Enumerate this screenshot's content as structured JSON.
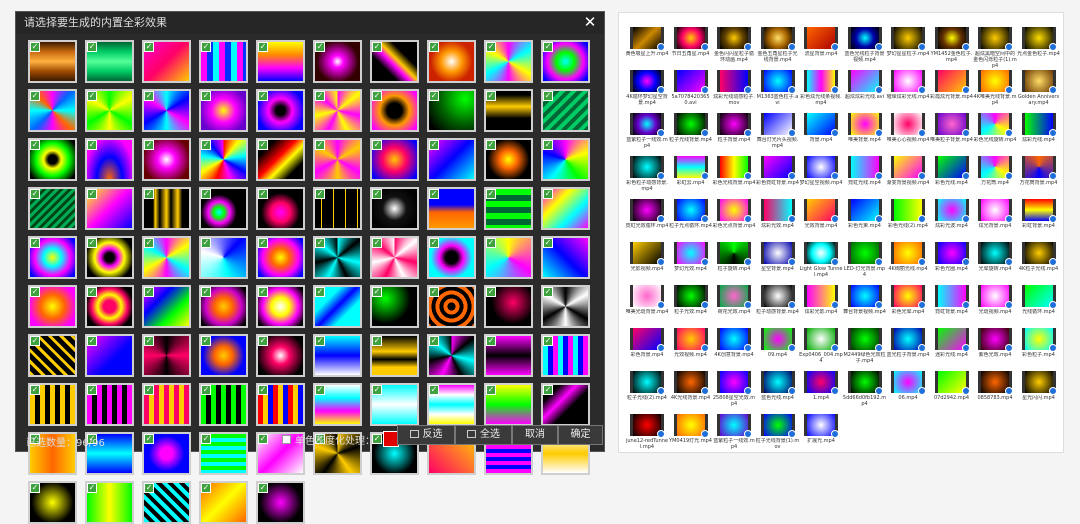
{
  "dialog": {
    "title": "请选择要生成的内置全彩效果",
    "close_label": "✕",
    "selected_count": "已选数量：96/96",
    "grayscale_label": "单色灰度化处理：",
    "grayscale_color": "#e00000",
    "buttons": {
      "invert": "反选",
      "select_all": "全选",
      "cancel": "取消",
      "ok": "确定"
    },
    "check_mark": "✓",
    "effects_accent": "#3da13d"
  },
  "effects": [
    "linear-gradient(180deg,#3a1a00,#c86a10,#ffb040,#a04a00,#3a1a00)",
    "linear-gradient(180deg,#063,#0c6,#5f9,#0c6,#063)",
    "linear-gradient(135deg,#f0c,#f06,#fc0)",
    "repeating-linear-gradient(90deg,#f0f 0 6px,#03f 6px 12px,#0ff 12px 18px)",
    "linear-gradient(180deg,#ff0,#f80,#f0f,#00f)",
    "radial-gradient(circle,#fff 0,#f0f 20%,#300 70%)",
    "linear-gradient(45deg,#000 30%,#f0f 45%,#fc0 55%,#000 70%)",
    "radial-gradient(circle,#fff 0,#f90 35%,#c20 70%)",
    "conic-gradient(#f0f,#0ff,#ff0,#f0f,#0ff,#ff0,#f0f)",
    "radial-gradient(circle,#0ff 0,#0f0 30%,#f0f 60%,#00f 90%)",
    "conic-gradient(#f0f,#06f,#0ff,#f60,#f0f,#06f,#0ff,#f60,#f0f)",
    "conic-gradient(#0f0,#ff0,#0f0,#ff0,#0f0,#ff0,#0f0)",
    "conic-gradient(#0ff,#00f,#f0f,#0ff,#00f,#f0f,#0ff)",
    "radial-gradient(circle,#ff0 0,#f0f 40%,#60c 80%)",
    "radial-gradient(circle,#000 15%,#f0f 40%,#00f 80%)",
    "conic-gradient(#f0f,#ff0,#f0f,#ff0,#f0f,#ff0,#f0f,#ff0)",
    "radial-gradient(circle,#000 25%,#f90 50%,#f0f 90%)",
    "radial-gradient(circle at 80% 20%,#0f0,#060 50%,#000 90%)",
    "linear-gradient(180deg,#000 10%,#fc0 40%,#000 70%)",
    "repeating-linear-gradient(135deg,#063 0 4px,#0c6 4px 8px)",
    "radial-gradient(circle,#000 15%,#ff0 30%,#0f0 55%,#000 90%)",
    "radial-gradient(ellipse at 50% 100%,#f60 0,#00f 40%,#f0f 80%)",
    "radial-gradient(circle,#fff 0,#f0f 30%,#600 80%)",
    "conic-gradient(#f00,#ff0,#0ff,#00f,#f0f,#f00,#ff0,#0ff,#00f,#f0f)",
    "linear-gradient(135deg,#000 20%,#f00 45%,#ff0 60%,#000 80%)",
    "conic-gradient(#f0f,#fc0,#f0f,#fc0,#f0f,#fc0,#f0f)",
    "radial-gradient(circle,#fc0 0,#f06 40%,#00f 90%)",
    "linear-gradient(135deg,#f0f,#00f 50%,#0ff)",
    "radial-gradient(circle,#ff0 0,#f60 30%,#000 70%)",
    "conic-gradient(#f0f,#ff0,#0f0,#0ff,#00f,#f0f)",
    "repeating-linear-gradient(135deg,#0a5 0 3px,#041 3px 6px)",
    "linear-gradient(135deg,#ff0,#f0f,#00f)",
    "linear-gradient(90deg,#000 20%,#fc0 25%,#000 35%,#fc0 50%,#000 60%,#fc0 75%,#000 85%)",
    "radial-gradient(circle at 40% 60%,#0ff 0,#0f0 15%,#f0f 30%,#000 50%)",
    "radial-gradient(circle at 50% 60%,#f0f 0,#f06 30%,#000 60%)",
    "repeating-linear-gradient(90deg,#000 0 6px,#fc0 6px 7px,#000 7px 12px)",
    "radial-gradient(circle,#fff 0,#111 40%,#000 80%)",
    "linear-gradient(180deg,#00f 40%,#f60 60%,#f90 100%)",
    "repeating-linear-gradient(180deg,#0f0 0 6px,#063 6px 12px)",
    "linear-gradient(135deg,#f0f,#ff0,#0ff,#f0f)",
    "radial-gradient(circle,#ff0 0,#0ff 30%,#f0f 60%,#00f 90%)",
    "radial-gradient(circle,#000 15%,#f0f 30%,#ff0 50%,#000 80%)",
    "conic-gradient(#f0f,#ff0,#0ff,#f0f,#ff0,#0ff,#f0f)",
    "conic-gradient(from 45deg,#00f,#0ff,#fff,#00f)",
    "radial-gradient(circle,#ff0 0,#f60 30%,#f0f 60%,#00f 90%)",
    "conic-gradient(#0ff,#000,#0ff,#000,#0ff,#000,#0ff,#000)",
    "conic-gradient(#f06,#fff,#f06,#fff,#f06,#fff,#f06,#fff)",
    "radial-gradient(circle,#000 20%,#f0f 40%,#0ff 70%)",
    "conic-gradient(#ff0,#f0f,#0ff,#ff0)",
    "linear-gradient(45deg,#0ff,#00f,#f0f)",
    "radial-gradient(circle,#ff0 0,#f60 40%,#f0f 80%)",
    "radial-gradient(circle,#f06 20%,#ff0 40%,#f06 60%,#000 80%)",
    "linear-gradient(135deg,#f0f,#00f,#0f0,#ff0)",
    "radial-gradient(circle,#fc0 0,#f60 30%,#c0c 60%,#000 90%)",
    "radial-gradient(circle,#fff 0,#ff0 30%,#f0f 60%,#000 90%)",
    "linear-gradient(135deg,#0ff 30%,#00f 50%,#0ff 70%)",
    "radial-gradient(circle at 30% 30%,#0f0 0,#000 60%)",
    "repeating-radial-gradient(circle,#000 0 4px,#f60 4px 8px)",
    "radial-gradient(circle at 60% 40%,#f06 0,#000 60%)",
    "conic-gradient(#000,#fff,#000,#fff,#000,#fff,#000)",
    "repeating-linear-gradient(45deg,#fc0 0 3px,#000 3px 8px)",
    "linear-gradient(135deg,#f0f,#00f 60%)",
    "conic-gradient(from 180deg,#000,#f06,#000,#f06,#000)",
    "radial-gradient(circle,#fc0 0,#f60 30%,#00f 70%)",
    "radial-gradient(circle,#fff 0,#f06 30%,#000 80%)",
    "linear-gradient(180deg,#0ff,#00f 50%,#fff)",
    "linear-gradient(180deg,#000,#fc0 40%,#000 60%,#fc0 80%)",
    "conic-gradient(#f0f,#000,#0ff,#000,#f0f,#000,#0ff,#000)",
    "linear-gradient(180deg,#f0f,#000,#f0f)",
    "repeating-linear-gradient(90deg,#0ff 0 5px,#00f 5px 10px,#f0f 10px 15px)",
    "repeating-linear-gradient(90deg,#fc0 0 5px,#000 5px 10px)",
    "repeating-linear-gradient(90deg,#f0f 0 5px,#000 5px 10px)",
    "repeating-linear-gradient(90deg,#f06 0 5px,#fc0 5px 10px)",
    "repeating-linear-gradient(90deg,#0f0 0 5px,#000 5px 10px)",
    "repeating-linear-gradient(90deg,#f00 0 5px,#fc0 5px 10px,#00f 10px 15px)",
    "linear-gradient(180deg,#fff,#0ff,#f0f,#ff0)",
    "linear-gradient(180deg,#0ff,#fff,#0ff)",
    "linear-gradient(180deg,#f0f,#fff,#0ff,#fff,#ff0)",
    "linear-gradient(180deg,#ff0,#0f0,#f0f)",
    "linear-gradient(135deg,#000 20%,#f0f 40%,#000 60%)",
    "linear-gradient(90deg,#fc0,#f60,#fc0)",
    "linear-gradient(180deg,#00f,#0ff,#00f)",
    "radial-gradient(circle,#f0f 20%,#00f 60%)",
    "repeating-linear-gradient(180deg,#0f0 0 4px,#0ff 4px 8px)",
    "linear-gradient(135deg,#fff,#f0f,#fff)",
    "conic-gradient(#fc0,#000,#fc0,#000,#fc0,#000)",
    "radial-gradient(circle,#0ff 0,#000 70%)",
    "linear-gradient(45deg,#f06,#fc0)",
    "repeating-linear-gradient(0deg,#f0f 0 4px,#00f 4px 8px)",
    "linear-gradient(180deg,#fff,#fc0,#fff)",
    "radial-gradient(circle,#ff0 0,#000 70%)",
    "linear-gradient(90deg,#0f0,#ff0,#0f0)",
    "repeating-linear-gradient(45deg,#0ff 0 4px,#000 4px 8px)",
    "linear-gradient(135deg,#f60,#ff0,#f60)",
    "radial-gradient(circle,#f0f 0,#000 70%)"
  ],
  "files": [
    {
      "name": "黄色吸星上升.mp4",
      "thumb": "linear-gradient(135deg,#000,#c80,#000)"
    },
    {
      "name": "节日五角星.mp4",
      "thumb": "radial-gradient(circle,#fc0,#f06,#000)"
    },
    {
      "name": "金色闪闪星粒子循环动画.mp4",
      "thumb": "radial-gradient(circle,#fc0,#640,#000)"
    },
    {
      "name": "金色五角星粒子光线背景.mp4",
      "thumb": "radial-gradient(circle,#fd6,#a60,#000)"
    },
    {
      "name": "流星背景.mp4",
      "thumb": "linear-gradient(135deg,#f60,#a00)"
    },
    {
      "name": "蓝色光线粒子背景视频.mp4",
      "thumb": "radial-gradient(circle,#0ff,#00a,#000)"
    },
    {
      "name": "梦幻星星粒子.mp4",
      "thumb": "radial-gradient(circle,#fc0,#000)"
    },
    {
      "name": "YM1452金色粒子.mp4",
      "thumb": "radial-gradient(circle,#ff0,#630,#000)"
    },
    {
      "name": "超炫黑暗空间中的金色闪烁粒子(1).mp4",
      "thumb": "radial-gradient(circle,#fc0,#000)"
    },
    {
      "name": "光点金色粒子.mp4",
      "thumb": "radial-gradient(circle,#fd0,#000)"
    },
    {
      "name": "4K循环梦幻星空背景.mp4",
      "thumb": "radial-gradient(circle,#f0f,#00f,#000)"
    },
    {
      "name": "5a7078420365 0.avi",
      "thumb": "linear-gradient(135deg,#00f,#f0f)"
    },
    {
      "name": "炫彩光线动感粒子.mov",
      "thumb": "linear-gradient(90deg,#f06,#00f)"
    },
    {
      "name": "M1363蓝色粒子.avi",
      "thumb": "radial-gradient(circle,#0ff,#00f)"
    },
    {
      "name": "彩色炫光线条视频.mp4",
      "thumb": "linear-gradient(90deg,#0ff,#f0f,#ff0)"
    },
    {
      "name": "超炫炫彩光线.avi",
      "thumb": "linear-gradient(135deg,#f0f,#0ff)"
    },
    {
      "name": "璀璨炫彩光线.mp4",
      "thumb": "radial-gradient(circle,#fff,#f0f)"
    },
    {
      "name": "彩霞炫光背景.mp4",
      "thumb": "linear-gradient(135deg,#f06,#fc0)"
    },
    {
      "name": "4K唯美光线背景.mp4",
      "thumb": "radial-gradient(circle,#ff0,#f60)"
    },
    {
      "name": "Golden Anniversary.mp4",
      "thumb": "radial-gradient(circle,#fd6,#630)"
    },
    {
      "name": "蓝紫粒子一线效.mp4",
      "thumb": "radial-gradient(circle,#0ff,#60c,#000)"
    },
    {
      "name": "粒子光线背景.mp4",
      "thumb": "radial-gradient(circle,#0f0,#000)"
    },
    {
      "name": "粒子背景.mp4",
      "thumb": "radial-gradient(circle,#f0f,#000)"
    },
    {
      "name": "舞台灯光片头视频.mp4",
      "thumb": "linear-gradient(135deg,#00f,#fff)"
    },
    {
      "name": "背景.mp4",
      "thumb": "linear-gradient(135deg,#0ff,#00f)"
    },
    {
      "name": "唯美背景.mp4",
      "thumb": "radial-gradient(circle,#f0f,#ff0)"
    },
    {
      "name": "唯美心心视频.mp4",
      "thumb": "radial-gradient(circle,#f06,#fff)"
    },
    {
      "name": "唯美粒子背景.mp4",
      "thumb": "radial-gradient(circle,#f6c,#60c)"
    },
    {
      "name": "彩色光线旋转.mp4",
      "thumb": "conic-gradient(#f0f,#ff0,#0ff,#f0f)"
    },
    {
      "name": "炫彩光线.mp4",
      "thumb": "linear-gradient(90deg,#0f0,#00f)"
    },
    {
      "name": "彩色粒子动感背景.mp4",
      "thumb": "radial-gradient(circle,#0ff,#000)"
    },
    {
      "name": "彩虹云.mp4",
      "thumb": "linear-gradient(180deg,#f0f,#0ff,#ff0)"
    },
    {
      "name": "彩色光线背景.mp4",
      "thumb": "linear-gradient(90deg,#f00,#ff0,#0f0)"
    },
    {
      "name": "彩色霓虹背景.mp4",
      "thumb": "linear-gradient(135deg,#f0f,#00f)"
    },
    {
      "name": "梦幻星空视频.mp4",
      "thumb": "radial-gradient(circle,#fff,#00f)"
    },
    {
      "name": "霓虹光线.mp4",
      "thumb": "linear-gradient(90deg,#0ff,#f0f)"
    },
    {
      "name": "渐变背景视频.mp4",
      "thumb": "linear-gradient(135deg,#ff0,#f0f)"
    },
    {
      "name": "彩色光线.mp4",
      "thumb": "linear-gradient(135deg,#0f0,#00f)"
    },
    {
      "name": "万花筒.mp4",
      "thumb": "conic-gradient(#f0f,#ff0,#0ff,#f0f)"
    },
    {
      "name": "万花筒背景.mp4",
      "thumb": "conic-gradient(#f60,#00f,#f60)"
    },
    {
      "name": "霓虹光效循环.mp4",
      "thumb": "radial-gradient(circle,#f0f,#000)"
    },
    {
      "name": "粒子光点循环.mp4",
      "thumb": "radial-gradient(circle,#0ff,#00f)"
    },
    {
      "name": "彩色光点背景.mp4",
      "thumb": "radial-gradient(circle,#ff0,#f0f)"
    },
    {
      "name": "炫彩光效.mp4",
      "thumb": "linear-gradient(90deg,#f06,#0ff)"
    },
    {
      "name": "光效背景.mp4",
      "thumb": "linear-gradient(135deg,#fc0,#f06)"
    },
    {
      "name": "彩色光束.mp4",
      "thumb": "linear-gradient(135deg,#00f,#0ff)"
    },
    {
      "name": "彩色光线(2).mp4",
      "thumb": "linear-gradient(90deg,#0f0,#ff0)"
    },
    {
      "name": "炫彩光波.mp4",
      "thumb": "radial-gradient(circle,#f0f,#0ff)"
    },
    {
      "name": "炫光背景.mp4",
      "thumb": "radial-gradient(circle,#fff,#f0f)"
    },
    {
      "name": "彩虹背景.mp4",
      "thumb": "linear-gradient(180deg,#f00,#ff0,#00f)"
    },
    {
      "name": "光影视频.mp4",
      "thumb": "linear-gradient(135deg,#fc0,#000)"
    },
    {
      "name": "梦幻光效.mp4",
      "thumb": "radial-gradient(circle,#0ff,#f0f)"
    },
    {
      "name": "粒子旋转.mp4",
      "thumb": "conic-gradient(#0f0,#000,#0f0)"
    },
    {
      "name": "星空背景.mp4",
      "thumb": "radial-gradient(circle,#fff,#00a)"
    },
    {
      "name": "Light Glow Tunnel.mp4",
      "thumb": "radial-gradient(circle,#fff,#0ff,#000)"
    },
    {
      "name": "LED-灯光背景.mp4",
      "thumb": "radial-gradient(circle,#0f0,#060)"
    },
    {
      "name": "4K绚丽光线.mp4",
      "thumb": "radial-gradient(circle,#ff0,#f60)"
    },
    {
      "name": "彩色光圈.mp4",
      "thumb": "radial-gradient(circle,#f0f,#00f)"
    },
    {
      "name": "光晕旋转.mp4",
      "thumb": "radial-gradient(circle,#0ff,#000)"
    },
    {
      "name": "4K粒子光线.mp4",
      "thumb": "radial-gradient(circle,#fc0,#000)"
    },
    {
      "name": "唯美光斑背景.mp4",
      "thumb": "radial-gradient(circle,#f6c,#fff)"
    },
    {
      "name": "粒子光效.mp4",
      "thumb": "radial-gradient(circle,#0f0,#000)"
    },
    {
      "name": "荷花光效.mp4",
      "thumb": "radial-gradient(circle,#f6c,#0a4)"
    },
    {
      "name": "粒子动感背景.mp4",
      "thumb": "radial-gradient(circle,#fff,#000)"
    },
    {
      "name": "炫彩光影.mp4",
      "thumb": "linear-gradient(90deg,#f0f,#ff0)"
    },
    {
      "name": "舞台背景视频.mp4",
      "thumb": "radial-gradient(circle,#0ff,#00f)"
    },
    {
      "name": "彩色光晕.mp4",
      "thumb": "radial-gradient(circle,#ff0,#f06)"
    },
    {
      "name": "霓虹背景.mp4",
      "thumb": "linear-gradient(90deg,#0ff,#f0f)"
    },
    {
      "name": "光斑视频.mp4",
      "thumb": "radial-gradient(circle,#fff,#f0f)"
    },
    {
      "name": "光线循环.mp4",
      "thumb": "linear-gradient(135deg,#0f0,#0ff)"
    },
    {
      "name": "彩色背景.mp4",
      "thumb": "linear-gradient(135deg,#f06,#00f)"
    },
    {
      "name": "光效视频.mp4",
      "thumb": "radial-gradient(circle,#fc0,#f06)"
    },
    {
      "name": "4K创意背景.mp4",
      "thumb": "radial-gradient(circle,#0ff,#00f)"
    },
    {
      "name": "09.mp4",
      "thumb": "radial-gradient(circle,#f0f,#0f0)"
    },
    {
      "name": "Exp0406_004.mp4",
      "thumb": "radial-gradient(circle,#fff,#0a0)"
    },
    {
      "name": "M2449绿色光效粒子.mp4",
      "thumb": "radial-gradient(circle,#0f0,#030)"
    },
    {
      "name": "蓝光粒子背景.mp4",
      "thumb": "radial-gradient(circle,#0ff,#00a)"
    },
    {
      "name": "迷彩光线.mp4",
      "thumb": "linear-gradient(135deg,#0f0,#f0f)"
    },
    {
      "name": "紫色光效.mp4",
      "thumb": "radial-gradient(circle,#f0f,#300)"
    },
    {
      "name": "彩色粒子.mp4",
      "thumb": "radial-gradient(circle,#ff0,#0ff)"
    },
    {
      "name": "粒子光线(2).mp4",
      "thumb": "radial-gradient(circle,#0ff,#000)"
    },
    {
      "name": "4K光线背景.mp4",
      "thumb": "radial-gradient(circle,#f60,#000)"
    },
    {
      "name": "25808星空光效.mp4",
      "thumb": "radial-gradient(circle,#f0f,#00f)"
    },
    {
      "name": "蓝色光线.mp4",
      "thumb": "radial-gradient(circle,#0ff,#006)"
    },
    {
      "name": "1.mp4",
      "thumb": "radial-gradient(circle,#f06,#00f)"
    },
    {
      "name": "5dd66d0fb192.mp4",
      "thumb": "radial-gradient(circle,#0f0,#000)"
    },
    {
      "name": "06.mp4",
      "thumb": "radial-gradient(circle,#f0f,#0ff)"
    },
    {
      "name": "07d2942.mp4",
      "thumb": "linear-gradient(135deg,#0f0,#ff0)"
    },
    {
      "name": "0858783.mp4",
      "thumb": "radial-gradient(circle,#f60,#000)"
    },
    {
      "name": "星光闪闪.mp4",
      "thumb": "radial-gradient(circle,#fc0,#000)"
    },
    {
      "name": "june12-redTunnel.mp4",
      "thumb": "radial-gradient(circle,#f00,#000)"
    },
    {
      "name": "YM0419灯光.mp4",
      "thumb": "radial-gradient(circle,#ff0,#f60)"
    },
    {
      "name": "蓝紫粒子一线效.mp4",
      "thumb": "radial-gradient(circle,#0ff,#60c)"
    },
    {
      "name": "粒子光线背景(1).mov",
      "thumb": "radial-gradient(circle,#0f0,#00f)"
    },
    {
      "name": "扩展光.mp4",
      "thumb": "radial-gradient(circle,#fff,#00f)"
    }
  ]
}
